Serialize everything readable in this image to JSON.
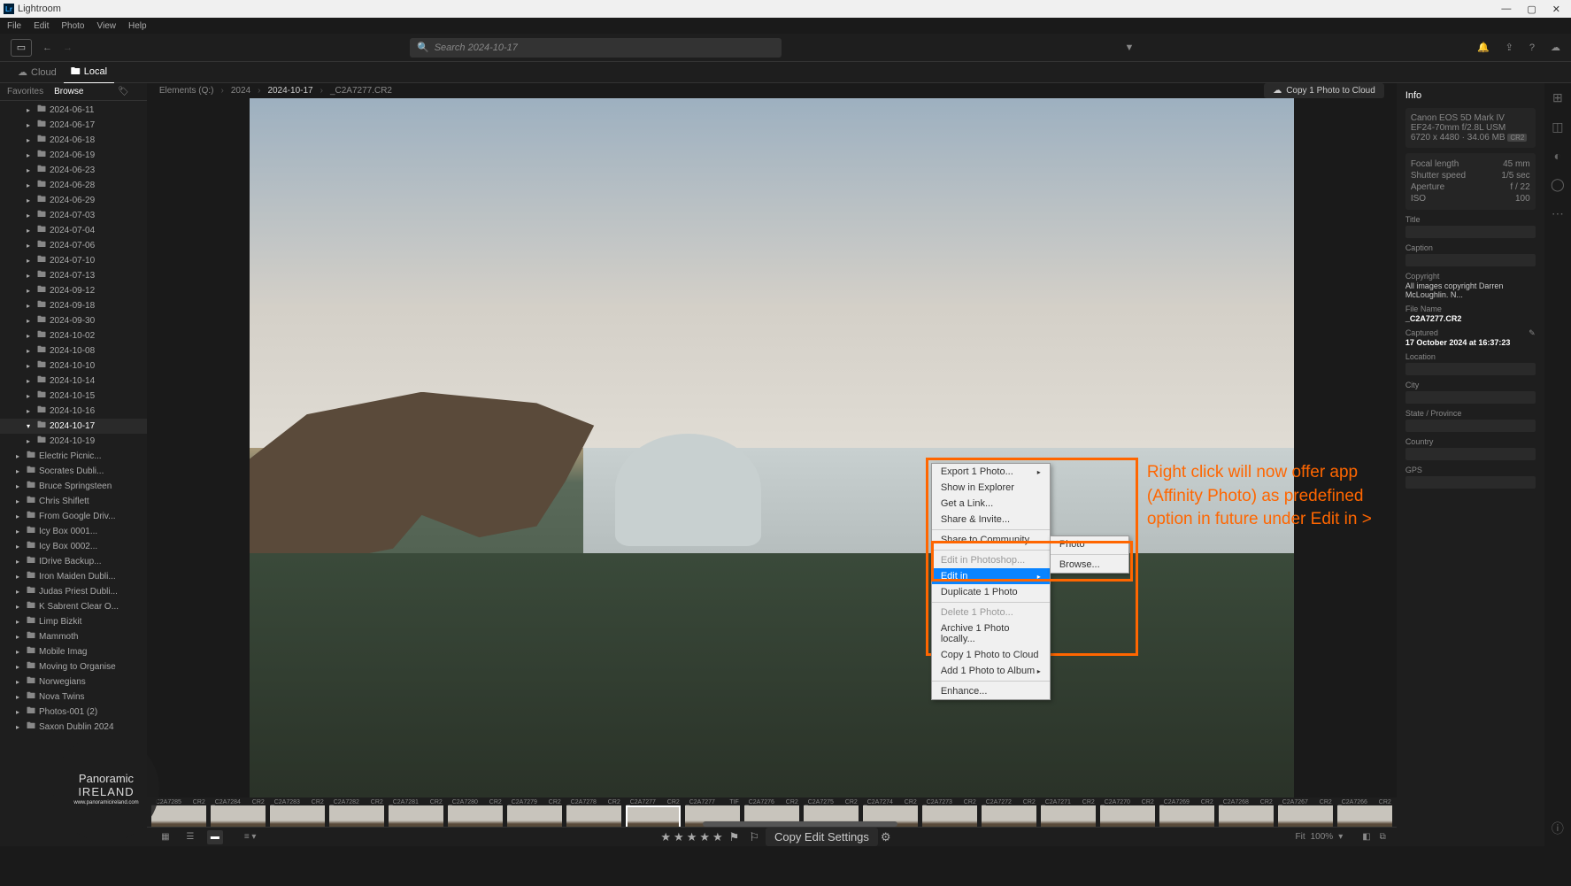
{
  "app_title": "Lightroom",
  "menu": [
    "File",
    "Edit",
    "Photo",
    "View",
    "Help"
  ],
  "search_placeholder": "Search 2024-10-17",
  "source_tabs": {
    "cloud": "Cloud",
    "local": "Local"
  },
  "side_tabs": {
    "favorites": "Favorites",
    "browse": "Browse"
  },
  "tree_dates": [
    "2024-06-11",
    "2024-06-17",
    "2024-06-18",
    "2024-06-19",
    "2024-06-23",
    "2024-06-28",
    "2024-06-29",
    "2024-07-03",
    "2024-07-04",
    "2024-07-06",
    "2024-07-10",
    "2024-07-13",
    "2024-09-12",
    "2024-09-18",
    "2024-09-30",
    "2024-10-02",
    "2024-10-08",
    "2024-10-10",
    "2024-10-14",
    "2024-10-15",
    "2024-10-16",
    "2024-10-17",
    "2024-10-19"
  ],
  "tree_selected": "2024-10-17",
  "tree_folders": [
    "Electric Picnic...",
    "Socrates Dubli...",
    "Bruce Springsteen",
    "Chris Shiflett",
    "From Google Driv...",
    "Icy Box 0001...",
    "Icy Box 0002...",
    "IDrive Backup...",
    "Iron Maiden Dubli...",
    "Judas Priest Dubli...",
    "K Sabrent Clear O...",
    "Limp Bizkit",
    "Mammoth",
    "Mobile Imag",
    "Moving to Organise",
    "Norwegians",
    "Nova Twins",
    "Photos-001 (2)",
    "Saxon Dublin 2024"
  ],
  "breadcrumb": [
    "Elements (Q:)",
    "2024",
    "2024-10-17",
    "_C2A7277.CR2"
  ],
  "copy_cloud": "Copy 1 Photo to Cloud",
  "ctx": {
    "export": "Export 1 Photo...",
    "explorer": "Show in Explorer",
    "link": "Get a Link...",
    "share": "Share & Invite...",
    "community": "Share to Community...",
    "editps": "Edit in Photoshop...",
    "editin": "Edit in",
    "duplicate": "Duplicate 1 Photo",
    "delete": "Delete 1 Photo...",
    "archive": "Archive 1 Photo locally...",
    "copycloud": "Copy 1 Photo to Cloud",
    "addalbum": "Add 1 Photo to Album",
    "enhance": "Enhance..."
  },
  "submenu": {
    "photo": "Photo",
    "browse": "Browse..."
  },
  "annotation": "Right click will now offer app (Affinity Photo) as predefined option in future under Edit in >",
  "thumbs": [
    "_C2A7285",
    "_C2A7284",
    "_C2A7283",
    "_C2A7282",
    "_C2A7281",
    "_C2A7280",
    "_C2A7279",
    "_C2A7278",
    "_C2A7277",
    "_C2A7277",
    "_C2A7276",
    "_C2A7275",
    "_C2A7274",
    "_C2A7273",
    "_C2A7272",
    "_C2A7271",
    "_C2A7270",
    "_C2A7269",
    "_C2A7268",
    "_C2A7267",
    "_C2A7266"
  ],
  "thumb_ext": "CR2",
  "thumb_tif": "TIF",
  "copy_settings": "Copy Edit Settings",
  "zoom": {
    "fit": "Fit",
    "pct": "100%"
  },
  "info": {
    "title": "Info",
    "camera": "Canon EOS 5D Mark IV",
    "lens": "EF24-70mm f/2.8L USM",
    "dims": "6720 x 4480",
    "size": "34.06 MB",
    "fmt": "CR2",
    "fl_label": "Focal length",
    "fl": "45 mm",
    "ss_label": "Shutter speed",
    "ss": "1/5 sec",
    "ap_label": "Aperture",
    "ap": "f / 22",
    "iso_label": "ISO",
    "iso": "100",
    "title_label": "Title",
    "caption_label": "Caption",
    "copyright_label": "Copyright",
    "copyright": "All images copyright Darren McLoughlin. N...",
    "filename_label": "File Name",
    "filename": "_C2A7277.CR2",
    "captured_label": "Captured",
    "captured": "17 October 2024 at 16:37:23",
    "location_label": "Location",
    "city_label": "City",
    "state_label": "State / Province",
    "country_label": "Country",
    "gps_label": "GPS"
  },
  "watermark": {
    "l1": "Panoramic",
    "l2": "IRELAND",
    "l3": "www.panoramicireland.com"
  }
}
